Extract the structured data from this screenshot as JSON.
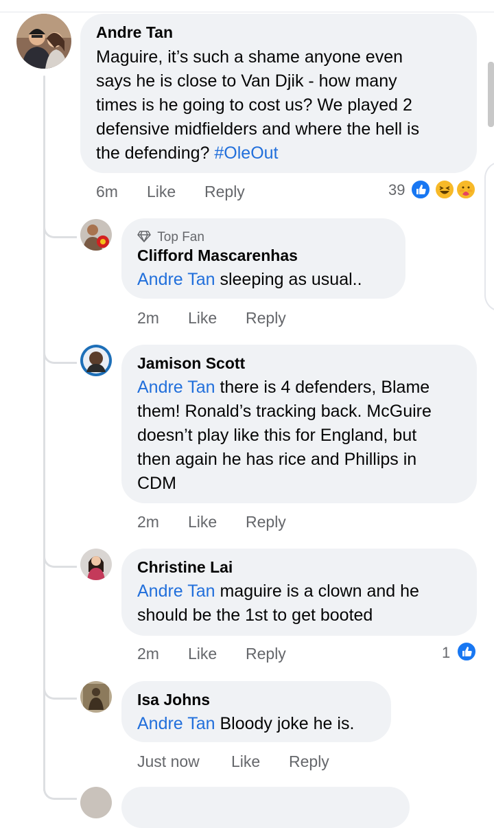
{
  "comments": [
    {
      "author": "Andre Tan",
      "text_lines": [
        "Maguire, it’s such a shame anyone even",
        "says he is close to Van Djik - how many",
        "times is he going to cost us? We played 2",
        "defensive midfielders and where the hell is",
        "the defending?"
      ],
      "hashtag": "#OleOut",
      "time": "6m",
      "like": "Like",
      "reply": "Reply",
      "reaction_count": "39",
      "reactions": [
        "like-icon",
        "haha-icon",
        "care-icon"
      ]
    }
  ],
  "replies": [
    {
      "badge": "Top Fan",
      "badge_icon": "diamond-icon",
      "author": "Clifford Mascarenhas",
      "mention": "Andre Tan",
      "text_lines": [
        " sleeping as usual.."
      ],
      "time": "2m",
      "like": "Like",
      "reply": "Reply"
    },
    {
      "author": "Jamison Scott",
      "mention": "Andre Tan",
      "text_lines": [
        " there is 4 defenders, Blame",
        "them! Ronald’s tracking back. McGuire",
        "doesn’t play like this for England, but",
        "then again he has rice and Phillips in",
        "CDM"
      ],
      "time": "2m",
      "like": "Like",
      "reply": "Reply"
    },
    {
      "author": "Christine Lai",
      "mention": "Andre Tan",
      "text_lines": [
        " maguire is a clown and he",
        "should be the 1st to get booted"
      ],
      "time": "2m",
      "like": "Like",
      "reply": "Reply",
      "reaction_count": "1",
      "reactions": [
        "like-icon"
      ]
    },
    {
      "author": "Isa Johns",
      "mention": "Andre Tan",
      "text_lines": [
        " Bloody joke he is."
      ],
      "time": "Just now",
      "like": "Like",
      "reply": "Reply"
    }
  ],
  "colors": {
    "bubble": "#f0f2f5",
    "link": "#216fdb",
    "meta": "#65676b",
    "like_blue": "#1877f2",
    "haha_yellow": "#f7b928"
  }
}
